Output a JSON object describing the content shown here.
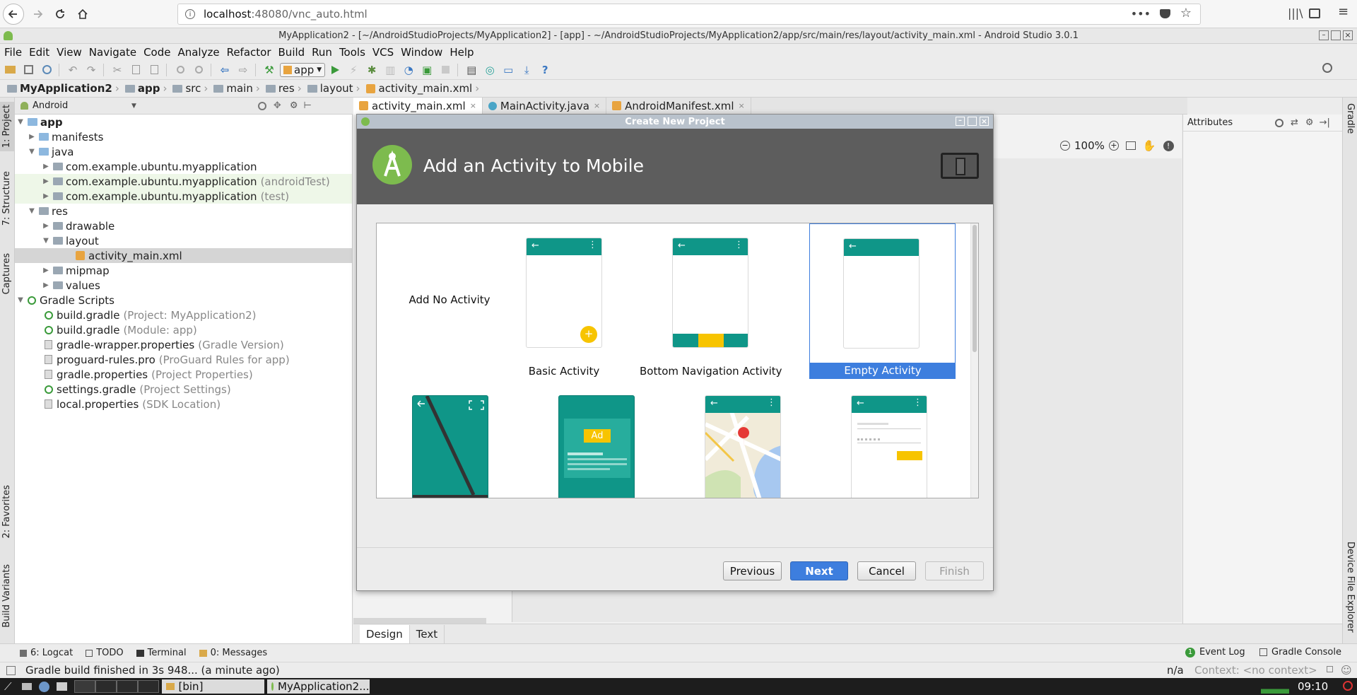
{
  "browser": {
    "url_host": "localhost",
    "url_rest": ":48080/vnc_auto.html"
  },
  "window": {
    "title": "MyApplication2 - [~/AndroidStudioProjects/MyApplication2] - [app] - ~/AndroidStudioProjects/MyApplication2/app/src/main/res/layout/activity_main.xml - Android Studio 3.0.1"
  },
  "menu": [
    "File",
    "Edit",
    "View",
    "Navigate",
    "Code",
    "Analyze",
    "Refactor",
    "Build",
    "Run",
    "Tools",
    "VCS",
    "Window",
    "Help"
  ],
  "toolbar": {
    "run_config": "app"
  },
  "breadcrumb": [
    "MyApplication2",
    "app",
    "src",
    "main",
    "res",
    "layout",
    "activity_main.xml"
  ],
  "left_stripe": [
    "1: Project",
    "7: Structure",
    "Captures",
    "2: Favorites",
    "Build Variants"
  ],
  "right_stripe": [
    "Gradle",
    "Device File Explorer"
  ],
  "project_panel": {
    "view": "Android"
  },
  "tree": [
    {
      "label": "app",
      "extra": "",
      "bold": true
    },
    {
      "label": "manifests",
      "extra": ""
    },
    {
      "label": "java",
      "extra": ""
    },
    {
      "label": "com.example.ubuntu.myapplication",
      "extra": ""
    },
    {
      "label": "com.example.ubuntu.myapplication",
      "extra": "(androidTest)"
    },
    {
      "label": "com.example.ubuntu.myapplication",
      "extra": "(test)"
    },
    {
      "label": "res",
      "extra": ""
    },
    {
      "label": "drawable",
      "extra": ""
    },
    {
      "label": "layout",
      "extra": ""
    },
    {
      "label": "activity_main.xml",
      "extra": ""
    },
    {
      "label": "mipmap",
      "extra": ""
    },
    {
      "label": "values",
      "extra": ""
    },
    {
      "label": "Gradle Scripts",
      "extra": ""
    },
    {
      "label": "build.gradle",
      "extra": "(Project: MyApplication2)"
    },
    {
      "label": "build.gradle",
      "extra": "(Module: app)"
    },
    {
      "label": "gradle-wrapper.properties",
      "extra": "(Gradle Version)"
    },
    {
      "label": "proguard-rules.pro",
      "extra": "(ProGuard Rules for app)"
    },
    {
      "label": "gradle.properties",
      "extra": "(Project Properties)"
    },
    {
      "label": "settings.gradle",
      "extra": "(Project Settings)"
    },
    {
      "label": "local.properties",
      "extra": "(SDK Location)"
    }
  ],
  "editor_tabs": [
    "activity_main.xml",
    "MainActivity.java",
    "AndroidManifest.xml"
  ],
  "editor": {
    "zoom": "100%",
    "attributes_title": "Attributes",
    "design_tab": "Design",
    "text_tab": "Text"
  },
  "dialog": {
    "window_title": "Create New Project",
    "heading": "Add an Activity to Mobile",
    "templates": [
      "Add No Activity",
      "Basic Activity",
      "Bottom Navigation Activity",
      "Empty Activity"
    ],
    "selected": "Empty Activity",
    "ad_label": "Ad",
    "buttons": {
      "previous": "Previous",
      "next": "Next",
      "cancel": "Cancel",
      "finish": "Finish"
    }
  },
  "tool_windows": {
    "logcat": "6: Logcat",
    "todo": "TODO",
    "terminal": "Terminal",
    "messages": "0: Messages",
    "event_log": "Event Log",
    "event_count": "1",
    "gradle_console": "Gradle Console"
  },
  "status": {
    "message": "Gradle build finished in 3s 948... (a minute ago)",
    "na": "n/a",
    "context": "Context: <no context>"
  },
  "taskbar": {
    "item1": "[bin]",
    "item2": "MyApplication2...",
    "clock": "09:10"
  },
  "colors": {
    "accent": "#3d7ede",
    "teal": "#0f9688",
    "amber": "#f7c400",
    "selection": "#3d7ede"
  }
}
